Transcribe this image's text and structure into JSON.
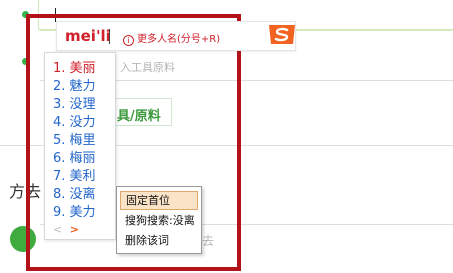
{
  "ime": {
    "composition": "mei'li",
    "hint_icon": "info-icon",
    "hint_text": "更多人名(分号+R)",
    "logo": "sogou-logo"
  },
  "candidates": [
    {
      "label": "1. 美丽"
    },
    {
      "label": "2. 魅力"
    },
    {
      "label": "3. 没理"
    },
    {
      "label": "4. 没力"
    },
    {
      "label": "5. 梅里"
    },
    {
      "label": "6. 梅丽"
    },
    {
      "label": "7. 美利"
    },
    {
      "label": "8. 没离"
    },
    {
      "label": "9. 美力"
    }
  ],
  "pager": {
    "prev": "<",
    "next": ">"
  },
  "context_menu": {
    "items": [
      {
        "label": "固定首位"
      },
      {
        "label": "搜狗搜索:没离"
      },
      {
        "label": "删除该词"
      }
    ]
  },
  "background": {
    "faded_field": "入工具原料",
    "button_label": "具/原料",
    "section_title": "方去",
    "bottom_faded": "去"
  },
  "colors": {
    "highlight": "#b3121b",
    "candidate": "#2266cc",
    "selected_candidate": "#d0202a",
    "accent_green": "#35b34a"
  }
}
